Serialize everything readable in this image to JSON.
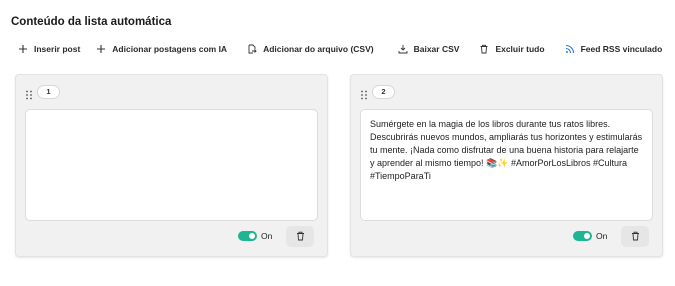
{
  "page_title": "Conteúdo da lista automática",
  "toolbar": {
    "insert_post": "Inserir post",
    "add_ai": "Adicionar postagens com IA",
    "add_file": "Adicionar do arquivo (CSV)",
    "download_csv": "Baixar CSV",
    "delete_all": "Excluir tudo",
    "rss_feed": "Feed RSS vinculado"
  },
  "posts": [
    {
      "number": "1",
      "text": "",
      "toggle_label": "On",
      "enabled": true
    },
    {
      "number": "2",
      "text": "Sumérgete en la magia de los libros durante tus ratos libres. Descubrirás nuevos mundos, ampliarás tus horizontes y estimularás tu mente. ¡Nada como disfrutar de una buena historia para relajarte y aprender al mismo tiempo! 📚✨ #AmorPorLosLibros #Cultura #TiempoParaTi",
      "toggle_label": "On",
      "enabled": true
    }
  ],
  "colors": {
    "toggle_on": "#1db594",
    "card_bg": "#f1f1f1"
  },
  "icons": [
    "plus-icon",
    "plus-icon",
    "file-import-icon",
    "download-icon",
    "trash-icon",
    "rss-icon",
    "drag-handle-icon",
    "trash-icon"
  ]
}
